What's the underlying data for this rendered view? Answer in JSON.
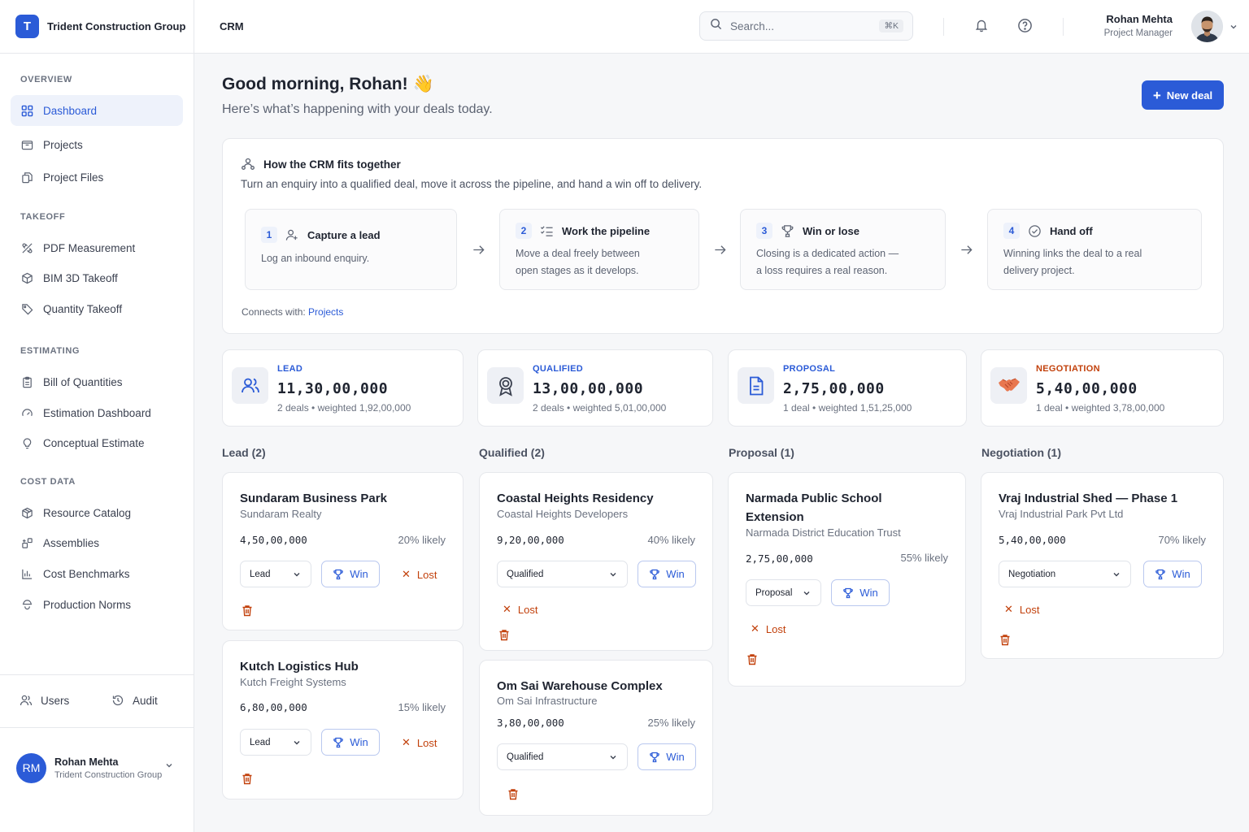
{
  "sidebar": {
    "brand_initial": "T",
    "brand_name": "Trident Construction Group",
    "sections": [
      {
        "title": "OVERVIEW"
      },
      {
        "title": "TAKEOFF"
      },
      {
        "title": "ESTIMATING"
      },
      {
        "title": "COST DATA"
      }
    ],
    "items": [
      {
        "label": "Dashboard",
        "icon": "grid-icon",
        "active": true
      },
      {
        "label": "Projects",
        "icon": "folder-icon"
      },
      {
        "label": "Project Files",
        "icon": "files-icon"
      },
      {
        "label": "PDF Measurement",
        "icon": "measure-icon"
      },
      {
        "label": "BIM 3D Takeoff",
        "icon": "cube-icon"
      },
      {
        "label": "Quantity Takeoff",
        "icon": "tag-icon"
      },
      {
        "label": "Bill of Quantities",
        "icon": "clipboard-icon"
      },
      {
        "label": "Estimation Dashboard",
        "icon": "gauge-icon"
      },
      {
        "label": "Conceptual Estimate",
        "icon": "bulb-icon"
      },
      {
        "label": "Resource Catalog",
        "icon": "box-icon"
      },
      {
        "label": "Assemblies",
        "icon": "blocks-icon"
      },
      {
        "label": "Cost Benchmarks",
        "icon": "bar-chart-icon"
      },
      {
        "label": "Production Norms",
        "icon": "worker-icon"
      }
    ],
    "footer": {
      "users_label": "Users",
      "audit_label": "Audit"
    },
    "user": {
      "initials": "RM",
      "name": "Rohan Mehta",
      "org": "Trident Construction Group"
    }
  },
  "topbar": {
    "title": "CRM",
    "search_placeholder": "Search...",
    "search_shortcut": "⌘K",
    "user_name": "Rohan Mehta",
    "user_role": "Project Manager"
  },
  "main": {
    "greeting": "Good morning, Rohan! 👋",
    "subtitle": "Here’s what’s happening with your deals today.",
    "new_deal_label": "New deal",
    "info": {
      "title": "How the CRM fits together",
      "description": "Turn an enquiry into a qualified deal, move it across the pipeline, and hand a win off to delivery.",
      "steps": [
        {
          "num": "1",
          "title": "Capture a lead",
          "line1": "Log an inbound enquiry.",
          "line2": ""
        },
        {
          "num": "2",
          "title": "Work the pipeline",
          "line1": "Move a deal freely between",
          "line2": "open stages as it develops."
        },
        {
          "num": "3",
          "title": "Win or lose",
          "line1": "Closing is a dedicated action —",
          "line2": "a loss requires a real reason."
        },
        {
          "num": "4",
          "title": "Hand off",
          "line1": "Winning links the deal to a real",
          "line2": "delivery project."
        }
      ],
      "connects_label": "Connects with:",
      "connects_link": "Projects"
    },
    "stats": [
      {
        "label": "LEAD",
        "value": "11,30,00,000",
        "sub": "2 deals • weighted 1,92,00,000",
        "icon": "users-icon"
      },
      {
        "label": "QUALIFIED",
        "value": "13,00,00,000",
        "sub": "2 deals • weighted 5,01,00,000",
        "icon": "award-icon"
      },
      {
        "label": "PROPOSAL",
        "value": "2,75,00,000",
        "sub": "1 deal • weighted 1,51,25,000",
        "icon": "document-icon"
      },
      {
        "label": "NEGOTIATION",
        "value": "5,40,00,000",
        "sub": "1 deal • weighted 3,78,00,000",
        "icon": "handshake-icon"
      }
    ],
    "columns": [
      {
        "title": "Lead (2)",
        "deals": [
          {
            "name": "Sundaram Business Park",
            "client": "Sundaram Realty",
            "amount": "4,50,00,000",
            "likely": "20% likely",
            "stage": "Lead"
          },
          {
            "name": "Kutch Logistics Hub",
            "client": "Kutch Freight Systems",
            "amount": "6,80,00,000",
            "likely": "15% likely",
            "stage": "Lead"
          }
        ]
      },
      {
        "title": "Qualified (2)",
        "deals": [
          {
            "name": "Coastal Heights Residency",
            "client": "Coastal Heights Developers",
            "amount": "9,20,00,000",
            "likely": "40% likely",
            "stage": "Qualified"
          },
          {
            "name": "Om Sai Warehouse Complex",
            "client": "Om Sai Infrastructure",
            "amount": "3,80,00,000",
            "likely": "25% likely",
            "stage": "Qualified"
          }
        ]
      },
      {
        "title": "Proposal (1)",
        "deals": [
          {
            "name": "Narmada Public School Extension",
            "name_line1": "Narmada Public School",
            "name_line2": "Extension",
            "client": "Narmada District Education Trust",
            "amount": "2,75,00,000",
            "likely": "55% likely",
            "stage": "Proposal"
          }
        ]
      },
      {
        "title": "Negotiation (1)",
        "deals": [
          {
            "name": "Vraj Industrial Shed — Phase 1",
            "client": "Vraj Industrial Park Pvt Ltd",
            "amount": "5,40,00,000",
            "likely": "70% likely",
            "stage": "Negotiation"
          }
        ]
      }
    ],
    "win_label": "Win",
    "lost_label": "Lost"
  },
  "colors": {
    "accent": "#2b5bd7",
    "danger": "#c2410c",
    "border": "#e6e8ec"
  }
}
